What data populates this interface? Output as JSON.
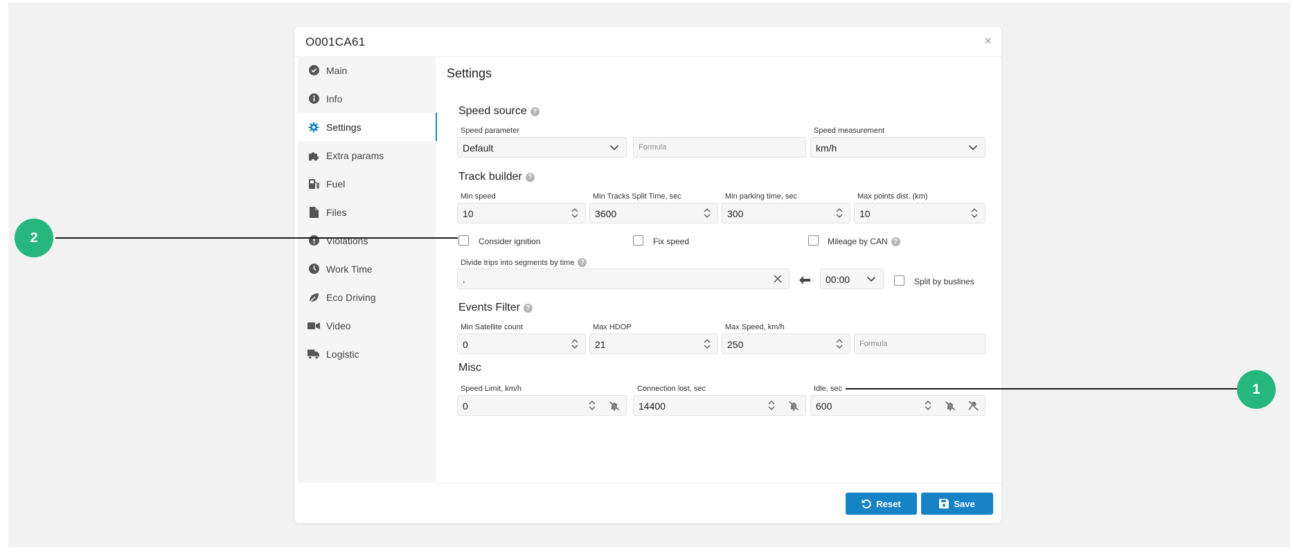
{
  "modal": {
    "title": "O001CA61",
    "close_label": "×"
  },
  "sidebar": {
    "items": [
      {
        "label": "Main",
        "icon": "check-circle-icon"
      },
      {
        "label": "Info",
        "icon": "info-circle-icon"
      },
      {
        "label": "Settings",
        "icon": "gear-icon",
        "active": true
      },
      {
        "label": "Extra params",
        "icon": "puzzle-icon"
      },
      {
        "label": "Fuel",
        "icon": "gas-pump-icon"
      },
      {
        "label": "Files",
        "icon": "file-icon"
      },
      {
        "label": "Violations",
        "icon": "exclamation-circle-icon"
      },
      {
        "label": "Work Time",
        "icon": "clock-icon"
      },
      {
        "label": "Eco Driving",
        "icon": "leaf-icon"
      },
      {
        "label": "Video",
        "icon": "video-camera-icon"
      },
      {
        "label": "Logistic",
        "icon": "truck-icon"
      }
    ]
  },
  "content": {
    "title": "Settings",
    "speed_source": {
      "title": "Speed source",
      "speed_parameter_label": "Speed parameter",
      "speed_parameter_value": "Default",
      "formula_placeholder": "Formula",
      "speed_measurement_label": "Speed measurement",
      "speed_measurement_value": "km/h"
    },
    "track_builder": {
      "title": "Track builder",
      "min_speed_label": "Min speed",
      "min_speed_value": "10",
      "split_time_label": "Min Tracks Split Time, sec",
      "split_time_value": "3600",
      "parking_time_label": "Min parking time, sec",
      "parking_time_value": "300",
      "max_points_label": "Max points dist. (km)",
      "max_points_value": "10",
      "consider_ignition_label": "Consider ignition",
      "fix_speed_label": "Fix speed",
      "mileage_by_can_label": "Mileage by CAN",
      "divide_trips_label": "Divide trips into segments by time",
      "divide_trips_value": ",",
      "time_value": "00:00",
      "split_by_buslines_label": "Split by buslines"
    },
    "events_filter": {
      "title": "Events Filter",
      "min_satellite_label": "Min Satellite count",
      "min_satellite_value": "0",
      "max_hdop_label": "Max HDOP",
      "max_hdop_value": "21",
      "max_speed_label": "Max Speed, km/h",
      "max_speed_value": "250",
      "formula_placeholder": "Formula"
    },
    "misc": {
      "title": "Misc",
      "speed_limit_label": "Speed Limit, km/h",
      "speed_limit_value": "0",
      "connection_lost_label": "Connection lost, sec",
      "connection_lost_value": "14400",
      "idle_label": "Idle, sec",
      "idle_value": "600"
    }
  },
  "footer": {
    "reset_label": "Reset",
    "save_label": "Save"
  },
  "callouts": {
    "one": "1",
    "two": "2"
  },
  "colors": {
    "accent": "#1683c6",
    "callout": "#26b77e"
  }
}
